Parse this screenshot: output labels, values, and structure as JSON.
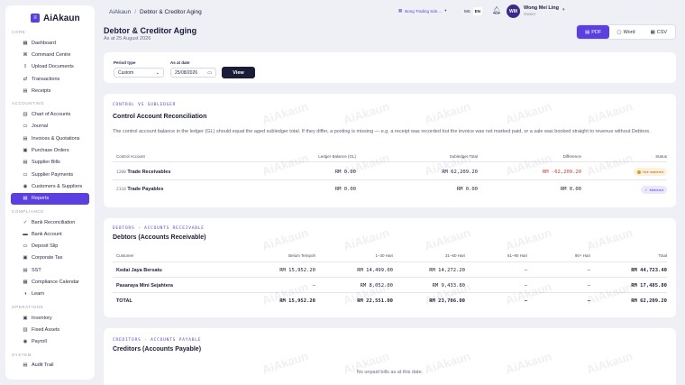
{
  "brand": {
    "name": "AiAkaun",
    "logo_glyph": "≡"
  },
  "sidebar": {
    "sections": [
      {
        "label": "CORE",
        "items": [
          {
            "label": "Dashboard",
            "icon": "grid-icon"
          },
          {
            "label": "Command Centre",
            "icon": "command-icon"
          },
          {
            "label": "Upload Documents",
            "icon": "upload-icon"
          },
          {
            "label": "Transactions",
            "icon": "swap-icon"
          },
          {
            "label": "Receipts",
            "icon": "receipt-icon"
          }
        ]
      },
      {
        "label": "ACCOUNTING",
        "items": [
          {
            "label": "Chart of Accounts",
            "icon": "chart-icon"
          },
          {
            "label": "Journal",
            "icon": "book-icon"
          },
          {
            "label": "Invoices & Quotations",
            "icon": "invoice-icon"
          },
          {
            "label": "Purchase Orders",
            "icon": "cart-icon"
          },
          {
            "label": "Supplier Bills",
            "icon": "bill-icon"
          },
          {
            "label": "Supplier Payments",
            "icon": "card-icon"
          },
          {
            "label": "Customers & Suppliers",
            "icon": "users-icon"
          },
          {
            "label": "Reports",
            "icon": "reports-icon",
            "active": true
          }
        ]
      },
      {
        "label": "COMPLIANCE",
        "items": [
          {
            "label": "Bank Reconciliation",
            "icon": "check-icon"
          },
          {
            "label": "Bank Account",
            "icon": "bank-icon"
          },
          {
            "label": "Deposit Slip",
            "icon": "slip-icon"
          },
          {
            "label": "Corporate Tax",
            "icon": "tax-icon"
          },
          {
            "label": "SST",
            "icon": "sst-icon"
          },
          {
            "label": "Compliance Calendar",
            "icon": "calendar-icon"
          },
          {
            "label": "Learn",
            "icon": "learn-icon"
          }
        ]
      },
      {
        "label": "OPERATIONS",
        "items": [
          {
            "label": "Inventory",
            "icon": "box-icon"
          },
          {
            "label": "Fixed Assets",
            "icon": "asset-icon"
          },
          {
            "label": "Payroll",
            "icon": "payroll-icon"
          }
        ]
      },
      {
        "label": "SYSTEM",
        "items": [
          {
            "label": "Audit Trail",
            "icon": "audit-icon"
          }
        ]
      }
    ]
  },
  "topbar": {
    "breadcrumb_root": "AiAkaun",
    "breadcrumb_sep": "/",
    "breadcrumb_current": "Debtor & Creditor Aging",
    "org_name": "Bong Trading Sdn....",
    "lang_ms": "MS",
    "lang_en": "EN",
    "avatar_initials": "WM",
    "user_name": "Wong Mei Ling",
    "user_role": "Owner"
  },
  "page": {
    "title": "Debtor & Creditor Aging",
    "subtitle": "As at 25 August 2026",
    "export_pdf": "PDF",
    "export_word": "Word",
    "export_csv": "CSV"
  },
  "filters": {
    "period_label": "Period type",
    "period_value": "Custom",
    "asof_label": "As at date",
    "asof_value": "25/08/2026",
    "view_label": "View"
  },
  "control": {
    "eyebrow": "CONTROL VS SUBLEDGER",
    "title": "Control Account Reconciliation",
    "description": "The control account balance in the ledger (GL) should equal the aged subledger total. If they differ, a posting is missing — e.g. a receipt was recorded but the invoice was not marked paid, or a sale was booked straight to revenue without Debtors.",
    "headers": {
      "account": "Control Account",
      "ledger": "Ledger Balance (GL)",
      "subledger": "Subledger Total",
      "difference": "Difference",
      "status": "Status"
    },
    "rows": [
      {
        "code": "1200",
        "name": "Trade Receivables",
        "ledger": "RM 0.00",
        "subledger": "RM 62,209.20",
        "difference": "RM -62,209.20",
        "status": "Not matched",
        "matched": false
      },
      {
        "code": "2110",
        "name": "Trade Payables",
        "ledger": "RM 0.00",
        "subledger": "RM 0.00",
        "difference": "RM 0.00",
        "status": "Matched",
        "matched": true
      }
    ]
  },
  "debtors": {
    "eyebrow": "DEBTORS · ACCOUNTS RECEIVABLE",
    "title": "Debtors (Accounts Receivable)",
    "headers": {
      "customer": "Customer",
      "not_due": "Belum Tempoh",
      "d1_30": "1–30 Hari",
      "d31_60": "31–60 Hari",
      "d61_90": "61–90 Hari",
      "d90p": "90+ Hari",
      "total": "Total"
    },
    "rows": [
      {
        "customer": "Kedai Jaya Bersatu",
        "not_due": "RM 15,952.20",
        "d1_30": "RM 14,499.00",
        "d31_60": "RM 14,272.20",
        "d61_90": "—",
        "d90p": "—",
        "total": "RM 44,723.40"
      },
      {
        "customer": "Pasaraya Mini Sejahtera",
        "not_due": "—",
        "d1_30": "RM 8,052.00",
        "d31_60": "RM 9,433.80",
        "d61_90": "—",
        "d90p": "—",
        "total": "RM 17,485.80"
      }
    ],
    "total_row": {
      "customer": "TOTAL",
      "not_due": "RM 15,952.20",
      "d1_30": "RM 22,551.00",
      "d31_60": "RM 23,706.00",
      "d61_90": "—",
      "d90p": "—",
      "total": "RM 62,209.20"
    }
  },
  "creditors": {
    "eyebrow": "CREDITORS · ACCOUNTS PAYABLE",
    "title": "Creditors (Accounts Payable)",
    "empty": "No unpaid bills as at this date."
  },
  "watermark": "AiAkaun",
  "colors": {
    "accent": "#5b3fe0",
    "negative": "#d9362b",
    "warning": "#e59a1a"
  }
}
